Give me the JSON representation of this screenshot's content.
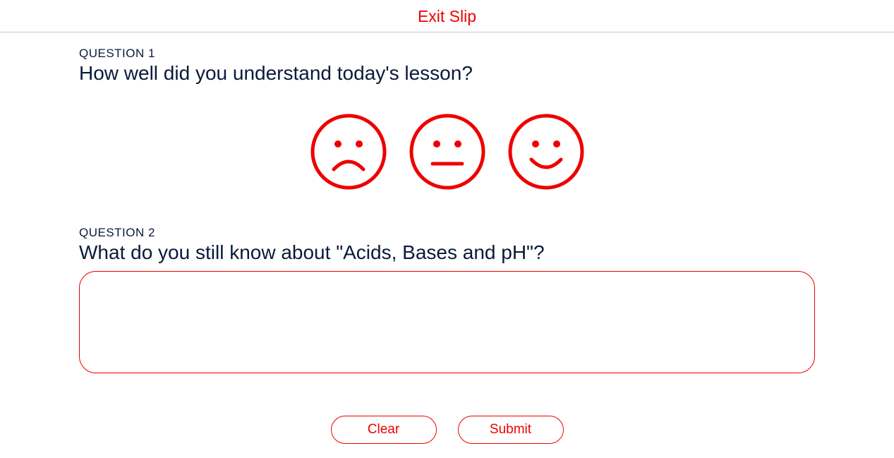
{
  "header": {
    "title": "Exit Slip"
  },
  "q1": {
    "label": "QUESTION 1",
    "text": "How well did you understand today's lesson?"
  },
  "q2": {
    "label": "QUESTION 2",
    "text": "What do you still know about \"Acids, Bases and pH\"?",
    "answer": ""
  },
  "buttons": {
    "clear": "Clear",
    "submit": "Submit"
  },
  "colors": {
    "accent": "#ee0000",
    "text": "#0a1a3a"
  }
}
